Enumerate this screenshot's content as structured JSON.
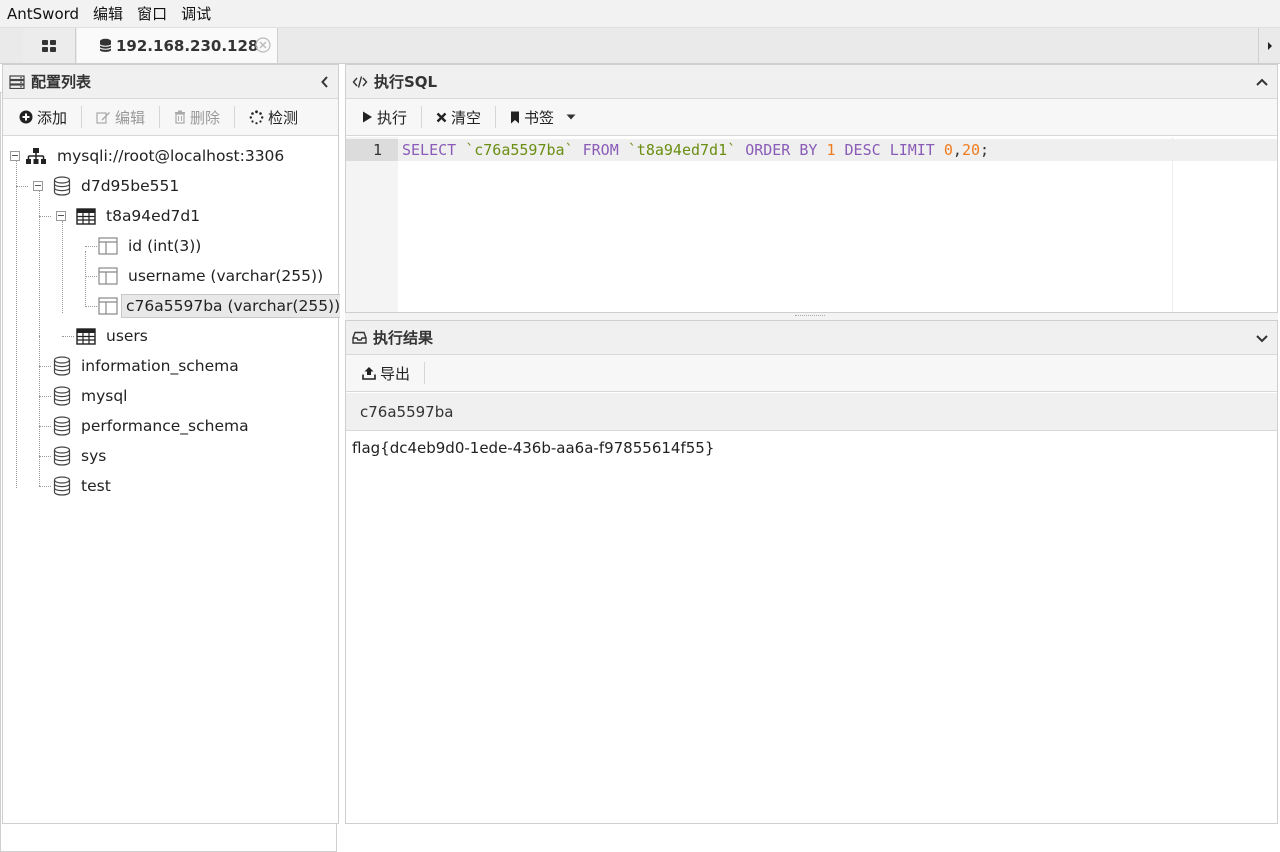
{
  "menu": [
    "AntSword",
    "编辑",
    "窗口",
    "调试"
  ],
  "tabs": {
    "host_label": "192.168.230.128"
  },
  "left_panel": {
    "title": "配置列表",
    "toolbar": {
      "add": "添加",
      "edit": "编辑",
      "delete": "删除",
      "check": "检测"
    },
    "tree": {
      "connection": "mysqli://root@localhost:3306",
      "db_current": "d7d95be551",
      "table_current": "t8a94ed7d1",
      "columns": [
        "id (int(3))",
        "username (varchar(255))",
        "c76a5597ba (varchar(255))"
      ],
      "table_other": "users",
      "databases": [
        "information_schema",
        "mysql",
        "performance_schema",
        "sys",
        "test"
      ]
    }
  },
  "sql_panel": {
    "title": "执行SQL",
    "toolbar": {
      "run": "执行",
      "clear": "清空",
      "bookmark": "书签"
    },
    "editor": {
      "line_number": "1",
      "tokens": {
        "select": "SELECT",
        "col": "`c76a5597ba`",
        "from": "FROM",
        "table": "`t8a94ed7d1`",
        "orderby": "ORDER BY",
        "n1": "1",
        "desc": "DESC",
        "limit": "LIMIT",
        "n0": "0",
        "comma": ",",
        "n20": "20",
        "semi": ";"
      }
    }
  },
  "result_panel": {
    "title": "执行结果",
    "toolbar": {
      "export": "导出"
    },
    "column_header": "c76a5597ba",
    "rows": [
      "flag{dc4eb9d0-1ede-436b-aa6a-f97855614f55}"
    ]
  }
}
